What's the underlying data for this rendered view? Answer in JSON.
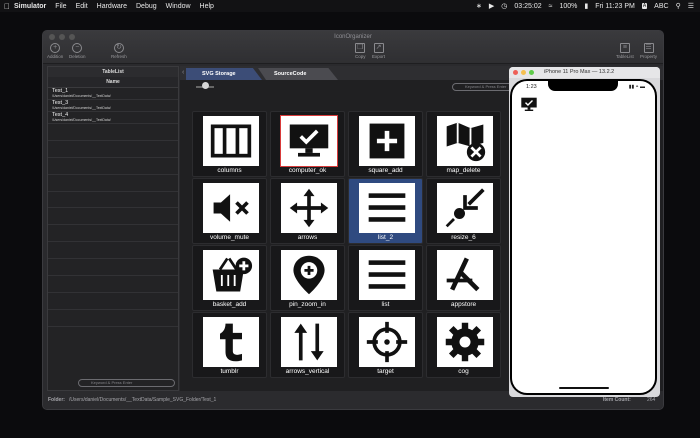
{
  "menubar": {
    "items": [
      "Simulator",
      "File",
      "Edit",
      "Hardware",
      "Debug",
      "Window",
      "Help"
    ],
    "clock_elapsed": "03:25:02",
    "battery": "100%",
    "datetime": "Fri 11:23 PM",
    "user_initial": "A",
    "input_source": "ABC"
  },
  "window": {
    "title": "IconOrganizer",
    "toolbar": {
      "addition": "Addition",
      "deletion": "Deletion",
      "refresh": "Refresh",
      "copy": "Copy",
      "export": "Export",
      "tablelist": "TableList",
      "property": "Property"
    }
  },
  "sidebar": {
    "title": "TableList",
    "column_header": "Name",
    "rows": [
      {
        "name": "Test_1",
        "path": "/Users/daniel/Documents/__TextData/"
      },
      {
        "name": "Test_3",
        "path": "/Users/daniel/Documents/__TextData/"
      },
      {
        "name": "Test_4",
        "path": "/Users/daniel/Documents/__TextData/"
      }
    ],
    "search_placeholder": "Keyword & Press Enter"
  },
  "main": {
    "tabs": [
      {
        "label": "SVG Storage"
      },
      {
        "label": "SourceCode"
      }
    ],
    "search_placeholder": "Keyword & Press Enter",
    "icons": [
      {
        "name": "columns",
        "glyph": "columns-icon"
      },
      {
        "name": "computer_ok",
        "glyph": "computer-ok-icon"
      },
      {
        "name": "square_add",
        "glyph": "square-add-icon"
      },
      {
        "name": "map_delete",
        "glyph": "map-delete-icon"
      },
      {
        "name": "volume_mute",
        "glyph": "volume-mute-icon"
      },
      {
        "name": "arrows",
        "glyph": "arrows-icon"
      },
      {
        "name": "list_2",
        "glyph": "list-icon"
      },
      {
        "name": "resize_6",
        "glyph": "resize-icon"
      },
      {
        "name": "basket_add",
        "glyph": "basket-add-icon"
      },
      {
        "name": "pin_zoom_in",
        "glyph": "pin-zoom-in-icon"
      },
      {
        "name": "list",
        "glyph": "list-icon"
      },
      {
        "name": "appstore",
        "glyph": "appstore-icon"
      },
      {
        "name": "tumblr",
        "glyph": "tumblr-icon"
      },
      {
        "name": "arrows_vertical",
        "glyph": "arrows-vertical-icon"
      },
      {
        "name": "target",
        "glyph": "target-icon"
      },
      {
        "name": "cog",
        "glyph": "cog-icon"
      }
    ],
    "selected_icon": "computer_ok",
    "highlighted_icon": "list_2"
  },
  "statusbar": {
    "folder_label": "Folder:",
    "folder_path": "/Users/daniel/Documents/__TextData/Sample_SVG_Folder/Test_1",
    "count_label": "Item Count:",
    "count_value": "264"
  },
  "simulator": {
    "title": "iPhone 11 Pro Max — 13.2.2",
    "status_time": "1:23",
    "status_right": "▮▮ ◓ ▬"
  }
}
